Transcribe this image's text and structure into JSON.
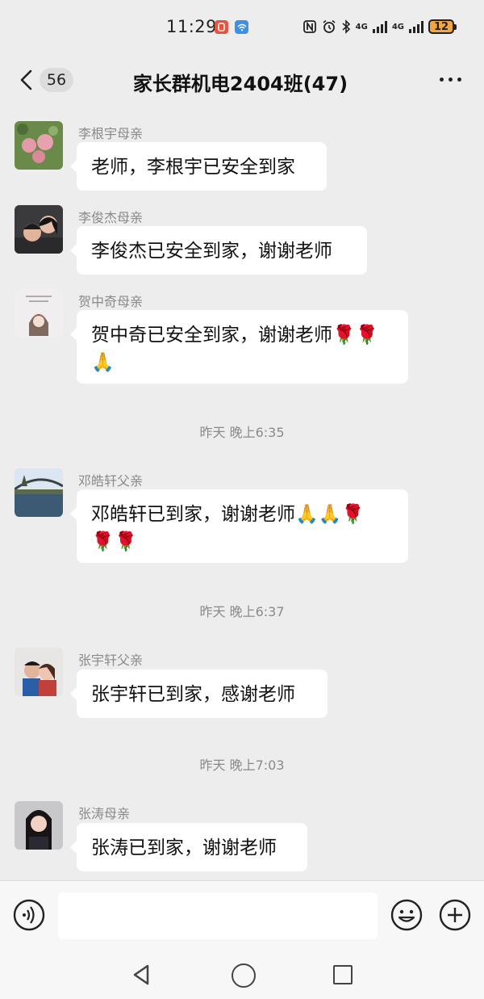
{
  "status": {
    "time": "11:29",
    "battery": "12",
    "net1": "4G",
    "net2": "4G"
  },
  "header": {
    "unread_count": "56",
    "title": "家长群机电2404班(47)"
  },
  "messages": [
    {
      "sender": "李根宇母亲",
      "text": "老师，李根宇已安全到家"
    },
    {
      "sender": "李俊杰母亲",
      "text": "李俊杰已安全到家，谢谢老师"
    },
    {
      "sender": "贺中奇母亲",
      "line1": "贺中奇已安全到家，谢谢老师🌹🌹",
      "line2": "🙏"
    },
    {
      "sender": "邓皓轩父亲",
      "line1": "邓皓轩已到家，谢谢老师🙏🙏🌹",
      "line2": "🌹🌹"
    },
    {
      "sender": "张宇轩父亲",
      "text": "张宇轩已到家，感谢老师"
    },
    {
      "sender": "张涛母亲",
      "text": "张涛已到家，谢谢老师"
    }
  ],
  "timestamps": [
    "昨天 晚上6:35",
    "昨天 晚上6:37",
    "昨天 晚上7:03"
  ],
  "composer": {
    "placeholder": ""
  },
  "colors": {
    "background": "#ededed",
    "bubble": "#ffffff",
    "meta_text": "#8a8a8a"
  }
}
